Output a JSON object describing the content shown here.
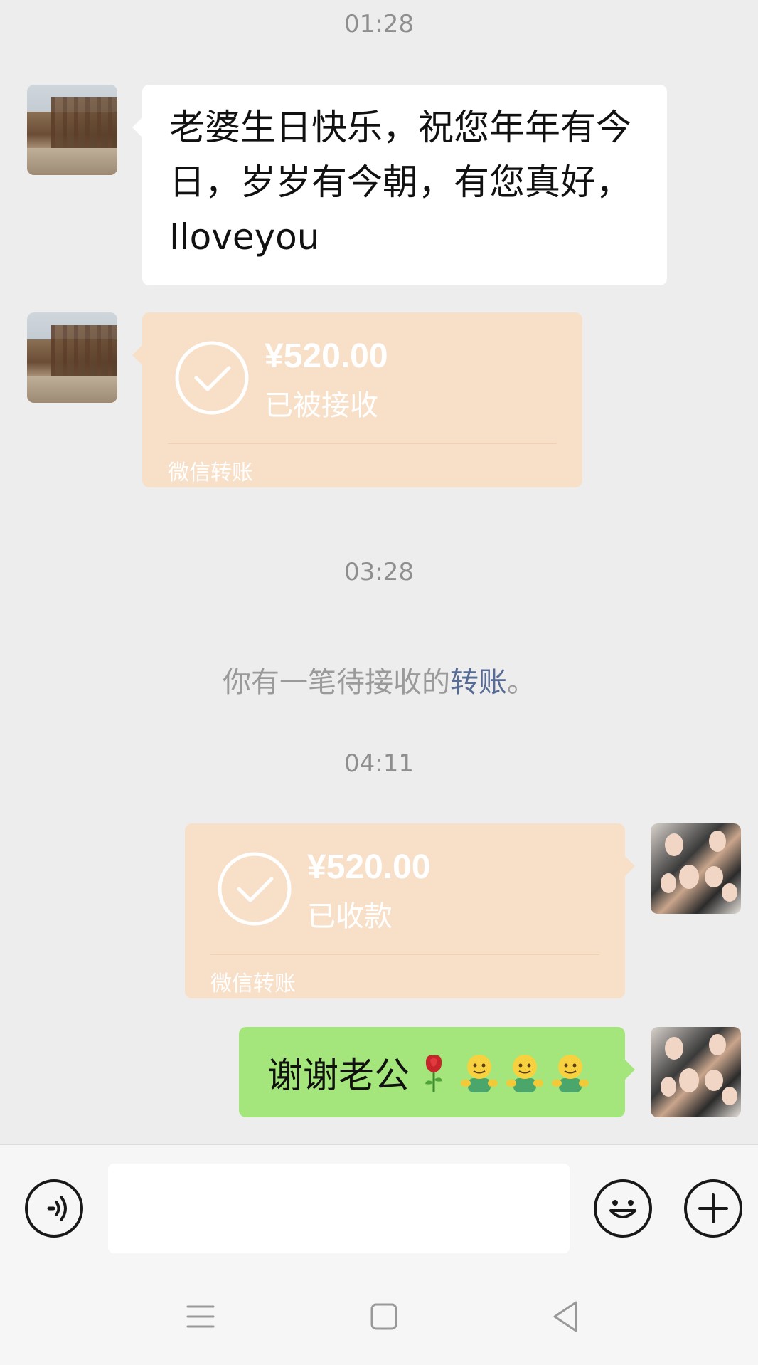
{
  "chat": {
    "timestamps": [
      "01:28",
      "03:28",
      "04:11"
    ],
    "messages": [
      {
        "type": "text",
        "side": "left",
        "text": "老婆生日快乐，祝您年年有今日，岁岁有今朝，有您真好，Iloveyou"
      },
      {
        "type": "transfer",
        "side": "left",
        "amount": "¥520.00",
        "status": "已被接收",
        "brand": "微信转账"
      },
      {
        "type": "transfer",
        "side": "right",
        "amount": "¥520.00",
        "status": "已收款",
        "brand": "微信转账"
      },
      {
        "type": "text",
        "side": "right",
        "text": "谢谢老公",
        "emojis": [
          "rose-emoji",
          "smile-emoji",
          "smile-emoji",
          "smile-emoji"
        ]
      }
    ],
    "system_notice": {
      "prefix": "你有一笔待接收的",
      "link": "转账",
      "suffix": "。"
    }
  },
  "input_bar": {
    "voice_icon": "voice-icon",
    "input_value": "",
    "emoji_icon": "emoji-icon",
    "plus_icon": "plus-icon"
  },
  "nav": {
    "icons": [
      "menu-icon",
      "home-icon",
      "back-icon"
    ]
  },
  "colors": {
    "background": "#ededed",
    "transfer_bubble": "#f8e0c8",
    "sent_bubble": "#a5e67c",
    "link": "#576b95"
  }
}
